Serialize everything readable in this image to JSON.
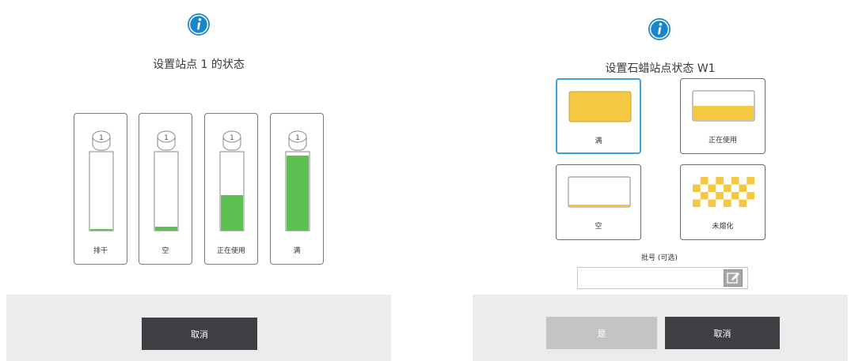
{
  "left_dialog": {
    "title": "设置站点 1 的状态",
    "bottles": [
      {
        "label": "排干",
        "fill_fraction": 0.01,
        "cap_text": "1"
      },
      {
        "label": "空",
        "fill_fraction": 0.05,
        "cap_text": "1"
      },
      {
        "label": "正在使用",
        "fill_fraction": 0.45,
        "cap_text": "1"
      },
      {
        "label": "满",
        "fill_fraction": 0.95,
        "cap_text": "1"
      }
    ],
    "cancel_label": "取消"
  },
  "right_dialog": {
    "title": "设置石蜡站点状态 W1",
    "states": [
      {
        "label": "满",
        "kind": "full",
        "selected": true
      },
      {
        "label": "正在使用",
        "kind": "in-use",
        "selected": false
      },
      {
        "label": "空",
        "kind": "empty",
        "selected": false
      },
      {
        "label": "未熔化",
        "kind": "unmelted",
        "selected": false
      }
    ],
    "lot_label": "批号 (可选)",
    "lot_value": "",
    "ok_label": "是",
    "cancel_label": "取消"
  },
  "colors": {
    "info_blue": "#1a86c9",
    "reagent_green": "#5cc052",
    "wax_yellow": "#f5c842",
    "selected_border": "#3aa2d8",
    "button_dark": "#3e3f43",
    "button_disabled": "#c4c4c6"
  },
  "icons": {
    "info": "info-circle-icon",
    "edit": "pencil-edit-icon"
  }
}
